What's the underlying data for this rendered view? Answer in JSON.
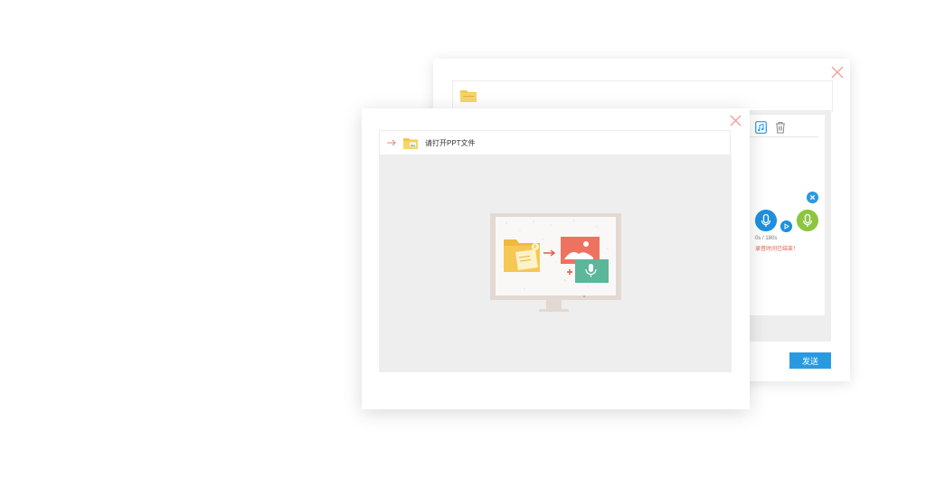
{
  "back_dialog": {
    "timer": "0s / 180s",
    "warning": "录音时间已结束！",
    "send_label": "发送",
    "icons": [
      "close-icon",
      "folder-icon",
      "music-file-icon",
      "trash-icon",
      "cancel-icon",
      "microphone-icon",
      "play-icon",
      "microphone-icon"
    ]
  },
  "front_dialog": {
    "open_ppt_label": "请打开PPT文件",
    "icons": [
      "close-icon",
      "arrow-right-icon",
      "folder-icon"
    ],
    "illustration": "monitor-ppt-to-image-and-audio"
  },
  "colors": {
    "accent_blue": "#2a9ae0",
    "close_red": "#f0a09a",
    "folder_yellow": "#f2c94c",
    "mic_green": "#8cc63f",
    "warning_red": "#e85a4a"
  }
}
